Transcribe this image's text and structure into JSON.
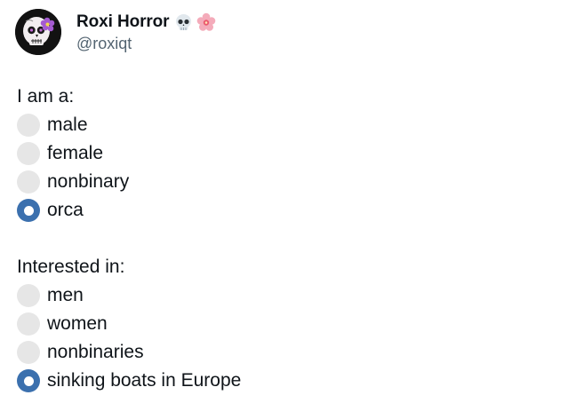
{
  "author": {
    "display_name": "Roxi Horror",
    "handle": "@roxiqt",
    "name_emojis": [
      "skull-emoji",
      "cherry-blossom-emoji"
    ]
  },
  "post": {
    "section_1": {
      "title": "I am a:",
      "options": [
        {
          "label": "male",
          "selected": false
        },
        {
          "label": "female",
          "selected": false
        },
        {
          "label": "nonbinary",
          "selected": false
        },
        {
          "label": "orca",
          "selected": true
        }
      ]
    },
    "section_2": {
      "title": "Interested in:",
      "options": [
        {
          "label": "men",
          "selected": false
        },
        {
          "label": "women",
          "selected": false
        },
        {
          "label": "nonbinaries",
          "selected": false
        },
        {
          "label": "sinking boats in Europe",
          "selected": true
        }
      ]
    }
  },
  "colors": {
    "radio_checked": "#3b70ae",
    "radio_unchecked": "#e6e6e6",
    "handle_text": "#536471",
    "text": "#0f1419"
  }
}
